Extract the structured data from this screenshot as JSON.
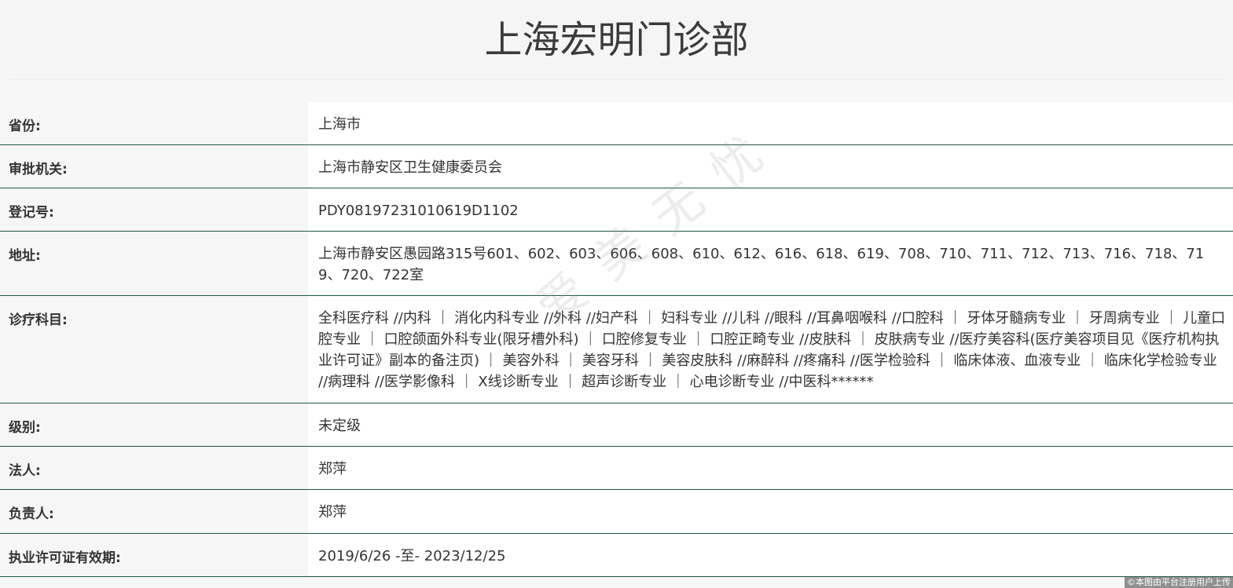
{
  "header": {
    "title": "上海宏明门诊部"
  },
  "rows": [
    {
      "label": "省份:",
      "value": "上海市"
    },
    {
      "label": "审批机关:",
      "value": "上海市静安区卫生健康委员会"
    },
    {
      "label": "登记号:",
      "value": "PDY08197231010619D1102"
    },
    {
      "label": "地址:",
      "value": "上海市静安区愚园路315号601、602、603、606、608、610、612、616、618、619、708、710、711、712、713、716、718、719、720、722室"
    },
    {
      "label": "诊疗科目:",
      "value": "全科医疗科 //内科 ｜ 消化内科专业 //外科 //妇产科 ｜ 妇科专业 //儿科 //眼科 //耳鼻咽喉科 //口腔科 ｜ 牙体牙髓病专业 ｜ 牙周病专业 ｜ 儿童口腔专业 ｜ 口腔颌面外科专业(限牙槽外科) ｜ 口腔修复专业 ｜ 口腔正畸专业 //皮肤科 ｜ 皮肤病专业 //医疗美容科(医疗美容项目见《医疗机构执业许可证》副本的备注页) ｜ 美容外科 ｜ 美容牙科 ｜ 美容皮肤科 //麻醉科 //疼痛科 //医学检验科 ｜ 临床体液、血液专业 ｜ 临床化学检验专业 //病理科 //医学影像科 ｜ X线诊断专业 ｜ 超声诊断专业 ｜ 心电诊断专业 //中医科******"
    },
    {
      "label": "级别:",
      "value": "未定级"
    },
    {
      "label": "法人:",
      "value": "郑萍"
    },
    {
      "label": "负责人:",
      "value": "郑萍"
    },
    {
      "label": "执业许可证有效期:",
      "value": "2019/6/26 -至- 2023/12/25"
    }
  ],
  "watermark": "爱 美 无 忧",
  "copyright": "©本图由平台注册用户上传"
}
